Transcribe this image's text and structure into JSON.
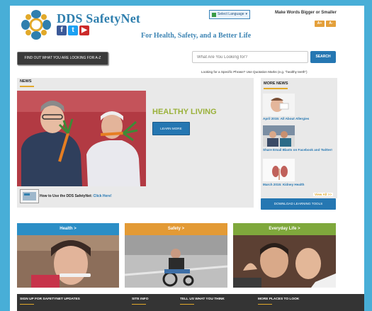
{
  "header": {
    "brand": "DDS SafetyNet",
    "tagline": "For Health, Safety, and a Better Life",
    "language_select": "Select Language",
    "bigger_text": "Make Words Bigger or Smaller",
    "zoom_in": "A+",
    "zoom_out": "A-",
    "social": [
      "f",
      "t",
      "▶"
    ]
  },
  "search": {
    "az_button": "FIND OUT WHAT YOU ARE LOOKING FOR A-Z",
    "placeholder": "What Are You Looking for?",
    "button": "SEARCH",
    "hint": "Looking for a Specific Phrase? Use Quotation Marks (e.g. \"healthy teeth\")"
  },
  "news": {
    "heading": "NEWS",
    "feature_title": "HEALTHY LIVING",
    "learn_more": "LEARN MORE",
    "howto_text": "How to Use the DDS SafetyNet: ",
    "howto_link": "Click Here!"
  },
  "more_news": {
    "heading": "MORE NEWS",
    "items": [
      "April 2015: All About Allergies",
      "Share Email Blasts on Facebook and Twitter!",
      "March 2015: Kidney Health"
    ],
    "view_all": "View All >>",
    "download": "DOWNLOAD LEARNING TOOLS"
  },
  "categories": [
    {
      "label": "Health >",
      "color": "#2b8ec6"
    },
    {
      "label": "Safety >",
      "color": "#e39a35"
    },
    {
      "label": "Everyday Life >",
      "color": "#7fa83c"
    }
  ],
  "footer": [
    "SIGN UP FOR SAFETYNET UPDATES",
    "SITE INFO",
    "TELL US WHAT YOU THINK",
    "MORE PLACES TO LOOK"
  ],
  "colors": {
    "frame": "#48aed7",
    "blue": "#2577b2",
    "gold": "#e2a92a",
    "green": "#9ab13a",
    "footer": "#343434"
  }
}
